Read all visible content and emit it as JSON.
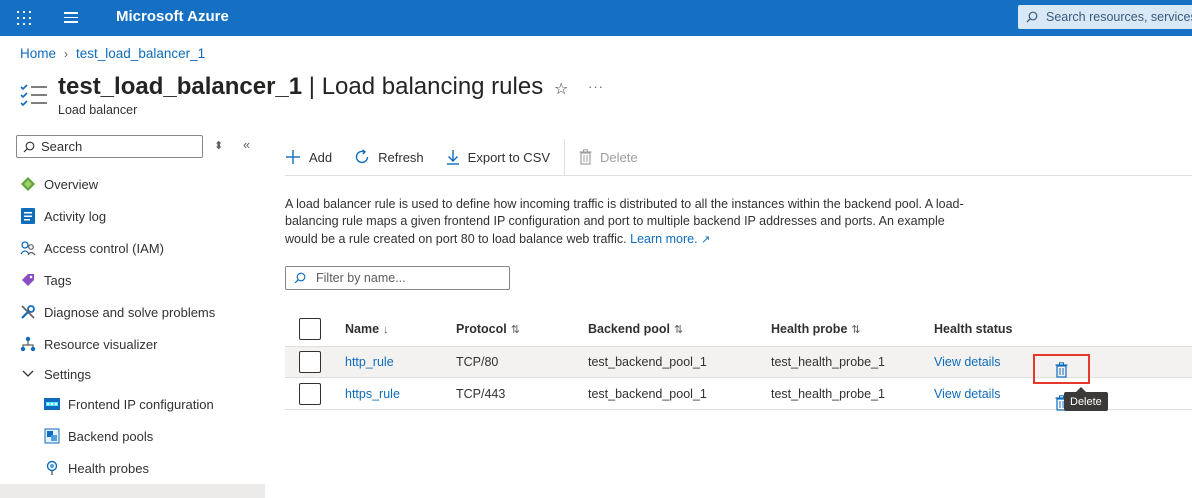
{
  "topbar": {
    "brand": "Microsoft Azure",
    "search_placeholder": "Search resources, services"
  },
  "breadcrumb": {
    "home": "Home",
    "resource": "test_load_balancer_1"
  },
  "header": {
    "resource_name": "test_load_balancer_1",
    "separator": " | ",
    "page_name": "Load balancing rules",
    "subtitle": "Load balancer"
  },
  "sidebar": {
    "search_placeholder": "Search",
    "items": [
      {
        "label": "Overview",
        "icon": "overview-icon"
      },
      {
        "label": "Activity log",
        "icon": "activity-log-icon"
      },
      {
        "label": "Access control (IAM)",
        "icon": "iam-icon"
      },
      {
        "label": "Tags",
        "icon": "tag-icon"
      },
      {
        "label": "Diagnose and solve problems",
        "icon": "wrench-icon"
      },
      {
        "label": "Resource visualizer",
        "icon": "visualizer-icon"
      },
      {
        "label": "Settings",
        "icon": "chevron-down-icon"
      },
      {
        "label": "Frontend IP configuration",
        "icon": "frontend-ip-icon"
      },
      {
        "label": "Backend pools",
        "icon": "backend-pool-icon"
      },
      {
        "label": "Health probes",
        "icon": "health-probe-icon"
      }
    ]
  },
  "toolbar": {
    "add": "Add",
    "refresh": "Refresh",
    "export": "Export to CSV",
    "delete": "Delete"
  },
  "description": {
    "text": "A load balancer rule is used to define how incoming traffic is distributed to all the instances within the backend pool. A load-balancing rule maps a given frontend IP configuration and port to multiple backend IP addresses and ports. An example would be a rule created on port 80 to load balance web traffic.",
    "learn_more": "Learn more."
  },
  "filter": {
    "placeholder": "Filter by name..."
  },
  "table": {
    "columns": {
      "name": "Name",
      "protocol": "Protocol",
      "backend_pool": "Backend pool",
      "health_probe": "Health probe",
      "health_status": "Health status"
    },
    "rows": [
      {
        "name": "http_rule",
        "protocol": "TCP/80",
        "backend_pool": "test_backend_pool_1",
        "health_probe": "test_health_probe_1",
        "health_status": "View details"
      },
      {
        "name": "https_rule",
        "protocol": "TCP/443",
        "backend_pool": "test_backend_pool_1",
        "health_probe": "test_health_probe_1",
        "health_status": "View details"
      }
    ]
  },
  "tooltip": {
    "text": "Delete"
  },
  "colors": {
    "brand_bar": "#1570c4",
    "link": "#0f6cbd",
    "highlight": "#e5392c"
  }
}
